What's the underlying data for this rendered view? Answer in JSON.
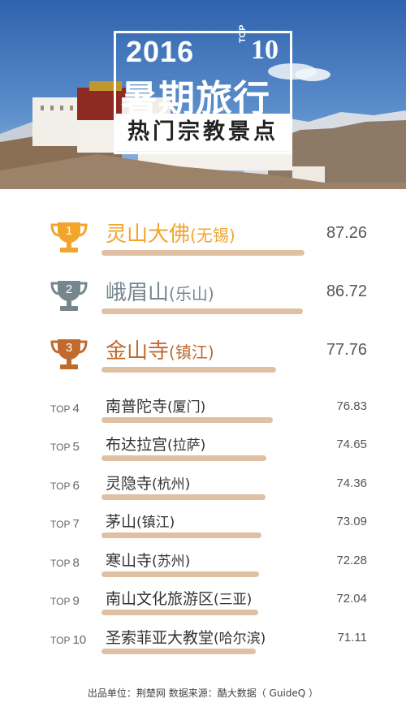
{
  "header": {
    "year": "2016",
    "top_label": "TOP",
    "top_number": "10",
    "title": "暑期旅行",
    "subtitle": "热门宗教景点"
  },
  "colors": {
    "gold": "#f2a52a",
    "silver": "#75868e",
    "bronze": "#c06a2e",
    "bar": "#e0c0a2",
    "sky": "#3d6fb4"
  },
  "chart_data": {
    "type": "bar",
    "title": "热门宗教景点",
    "categories": [
      "灵山大佛(无锡)",
      "峨眉山(乐山)",
      "金山寺(镇江)",
      "南普陀寺(厦门)",
      "布达拉宫(拉萨)",
      "灵隐寺(杭州)",
      "茅山(镇江)",
      "寒山寺(苏州)",
      "南山文化旅游区(三亚)",
      "圣索菲亚大教堂(哈尔滨)"
    ],
    "values": [
      87.26,
      86.72,
      77.76,
      76.83,
      74.65,
      74.36,
      73.09,
      72.28,
      72.04,
      71.11
    ]
  },
  "rows": [
    {
      "rank_label": "",
      "rank_num": "1",
      "name": "灵山大佛",
      "city": "(无锡)",
      "score": "87.26"
    },
    {
      "rank_label": "",
      "rank_num": "2",
      "name": "峨眉山",
      "city": "(乐山)",
      "score": "86.72"
    },
    {
      "rank_label": "",
      "rank_num": "3",
      "name": "金山寺",
      "city": "(镇江)",
      "score": "77.76"
    },
    {
      "rank_label": "TOP",
      "rank_num": "4",
      "name": "南普陀寺",
      "city": "(厦门)",
      "score": "76.83"
    },
    {
      "rank_label": "TOP",
      "rank_num": "5",
      "name": "布达拉宫",
      "city": "(拉萨)",
      "score": "74.65"
    },
    {
      "rank_label": "TOP",
      "rank_num": "6",
      "name": "灵隐寺",
      "city": "(杭州)",
      "score": "74.36"
    },
    {
      "rank_label": "TOP",
      "rank_num": "7",
      "name": "茅山",
      "city": "(镇江)",
      "score": "73.09"
    },
    {
      "rank_label": "TOP",
      "rank_num": "8",
      "name": "寒山寺",
      "city": "(苏州)",
      "score": "72.28"
    },
    {
      "rank_label": "TOP",
      "rank_num": "9",
      "name": "南山文化旅游区",
      "city": "(三亚)",
      "score": "72.04"
    },
    {
      "rank_label": "TOP",
      "rank_num": "10",
      "name": "圣索菲亚大教堂",
      "city": "(哈尔滨)",
      "score": "71.11"
    }
  ],
  "footer": {
    "text": "出品单位：荆楚网    数据来源：酷大数据（ GuideQ ）"
  }
}
